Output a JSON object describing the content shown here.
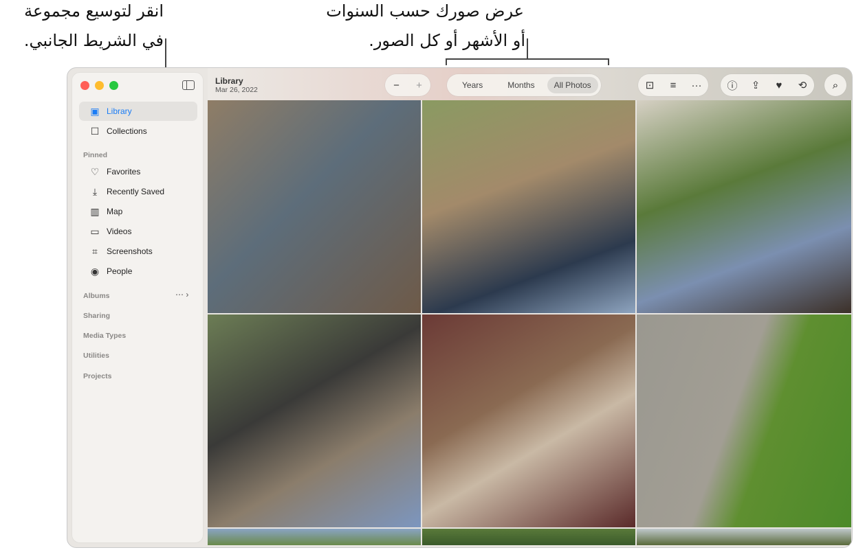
{
  "callouts": {
    "sidebar": [
      "انقر لتوسيع مجموعة",
      "في الشريط الجانبي."
    ],
    "view": [
      "عرض صورك حسب السنوات",
      "أو الأشهر أو كل الصور."
    ]
  },
  "sidebar": {
    "items": [
      {
        "label": "Library",
        "icon": "photo-stack-icon"
      },
      {
        "label": "Collections",
        "icon": "collections-icon"
      }
    ],
    "pinned_header": "Pinned",
    "pinned": [
      {
        "label": "Favorites",
        "icon": "heart-icon"
      },
      {
        "label": "Recently Saved",
        "icon": "download-icon"
      },
      {
        "label": "Map",
        "icon": "map-icon"
      },
      {
        "label": "Videos",
        "icon": "video-icon"
      },
      {
        "label": "Screenshots",
        "icon": "screenshot-icon"
      },
      {
        "label": "People",
        "icon": "person-circle-icon"
      }
    ],
    "sections": [
      "Albums",
      "Sharing",
      "Media Types",
      "Utilities",
      "Projects"
    ]
  },
  "header": {
    "title": "Library",
    "date": "Mar 26, 2022"
  },
  "view_tabs": [
    "Years",
    "Months",
    "All Photos"
  ],
  "selected_tab": "All Photos",
  "colors": {
    "accent": "#1a7cf5",
    "close": "#ff5f57",
    "minimize": "#febc2e",
    "zoom": "#28c840"
  },
  "photos": [
    "girl-in-car",
    "girl-on-car-hood",
    "feet-on-dashboard",
    "women-in-car",
    "woman-in-van-window",
    "ivy-on-wall",
    "tree",
    "tree",
    "tree"
  ]
}
